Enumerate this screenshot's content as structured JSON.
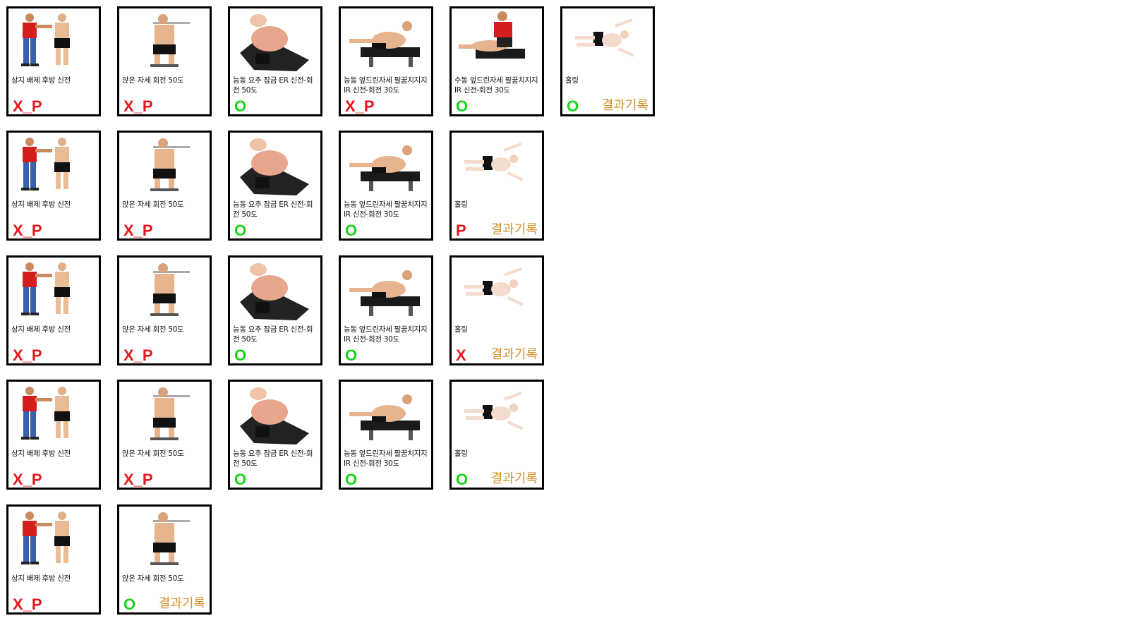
{
  "colors": {
    "red": "#e8161c",
    "green": "#18d418",
    "record": "#d6902c"
  },
  "rows": [
    {
      "cards": [
        {
          "icon": "standing-exam-figure",
          "label": "상지 배제 후방 신전",
          "result": "X_P",
          "result_color": "#e8161c",
          "record": ""
        },
        {
          "icon": "seated-rotation-figure",
          "label": "앉은 자세 회전 50도",
          "result": "X_P",
          "result_color": "#e8161c",
          "record": ""
        },
        {
          "icon": "lumbar-lock-figure",
          "label": "능동 요추 잠금 ER 신전-회전 50도",
          "result": "O",
          "result_color": "#18d418",
          "record": ""
        },
        {
          "icon": "prone-flexion-figure",
          "label": "능동 엎드린자세 팔꿈치지지 IR 신전-회전 30도",
          "result": "X_P",
          "result_color": "#e8161c",
          "record": ""
        },
        {
          "icon": "passive-prone-figure",
          "label": "수동 엎드린자세 팔꿈치지지 IR 신전-회전 30도",
          "result": "O",
          "result_color": "#18d418",
          "record": ""
        },
        {
          "icon": "swimming-figure",
          "label": "훌링",
          "result": "O",
          "result_color": "#18d418",
          "record": "결과기록"
        }
      ]
    },
    {
      "cards": [
        {
          "icon": "standing-exam-figure",
          "label": "상지 배제 후방 신전",
          "result": "X_P",
          "result_color": "#e8161c",
          "record": ""
        },
        {
          "icon": "seated-rotation-figure",
          "label": "앉은 자세 회전 50도",
          "result": "X_P",
          "result_color": "#e8161c",
          "record": ""
        },
        {
          "icon": "lumbar-lock-figure",
          "label": "능동 요추 잠금 ER 신전-회전 50도",
          "result": "O",
          "result_color": "#18d418",
          "record": ""
        },
        {
          "icon": "prone-flexion-figure",
          "label": "능동 엎드린자세 팔꿈치지지 IR 신전-회전 30도",
          "result": "O",
          "result_color": "#18d418",
          "record": ""
        },
        {
          "icon": "swimming-figure",
          "label": "훌링",
          "result": "P",
          "result_color": "#e8161c",
          "record": "결과기록"
        }
      ]
    },
    {
      "cards": [
        {
          "icon": "standing-exam-figure",
          "label": "상지 배제 후방 신전",
          "result": "X_P",
          "result_color": "#e8161c",
          "record": ""
        },
        {
          "icon": "seated-rotation-figure",
          "label": "앉은 자세 회전 50도",
          "result": "X_P",
          "result_color": "#e8161c",
          "record": ""
        },
        {
          "icon": "lumbar-lock-figure",
          "label": "능동 요추 잠금 ER 신전-회전 50도",
          "result": "O",
          "result_color": "#18d418",
          "record": ""
        },
        {
          "icon": "prone-flexion-figure",
          "label": "능동 엎드린자세 팔꿈치지지 IR 신전-회전 30도",
          "result": "O",
          "result_color": "#18d418",
          "record": ""
        },
        {
          "icon": "swimming-figure",
          "label": "훌링",
          "result": "X",
          "result_color": "#e8161c",
          "record": "결과기록"
        }
      ]
    },
    {
      "cards": [
        {
          "icon": "standing-exam-figure",
          "label": "상지 배제 후방 신전",
          "result": "X_P",
          "result_color": "#e8161c",
          "record": ""
        },
        {
          "icon": "seated-rotation-figure",
          "label": "앉은 자세 회전 50도",
          "result": "X_P",
          "result_color": "#e8161c",
          "record": ""
        },
        {
          "icon": "lumbar-lock-figure",
          "label": "능동 요추 잠금 ER 신전-회전 50도",
          "result": "O",
          "result_color": "#18d418",
          "record": ""
        },
        {
          "icon": "prone-flexion-figure",
          "label": "능동 엎드린자세 팔꿈치지지 IR 신전-회전 30도",
          "result": "O",
          "result_color": "#18d418",
          "record": ""
        },
        {
          "icon": "swimming-figure",
          "label": "훌링",
          "result": "O",
          "result_color": "#18d418",
          "record": "결과기록"
        }
      ]
    },
    {
      "cards": [
        {
          "icon": "standing-exam-figure",
          "label": "상지 배제 후방 신전",
          "result": "X_P",
          "result_color": "#e8161c",
          "record": ""
        },
        {
          "icon": "seated-rotation-figure",
          "label": "앉은 자세 회전 50도",
          "result": "O",
          "result_color": "#18d418",
          "record": "결과기록"
        }
      ]
    }
  ]
}
